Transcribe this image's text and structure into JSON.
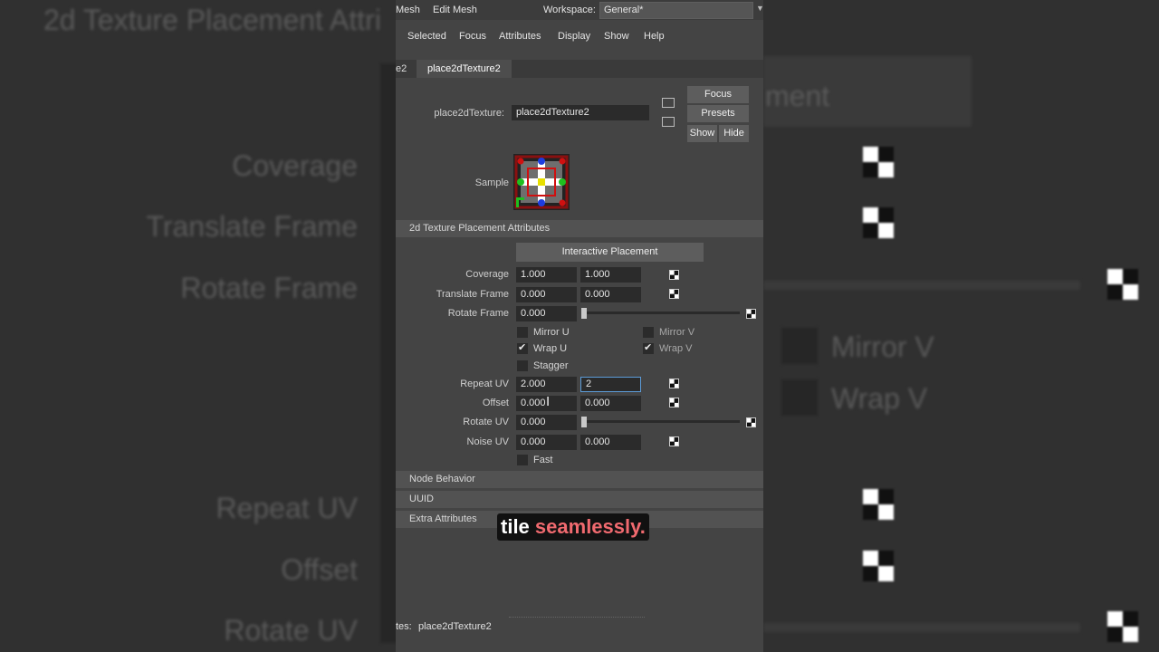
{
  "background": {
    "left_labels": [
      "2d Texture Placement Attri",
      "Coverage",
      "Translate Frame",
      "Rotate Frame",
      "Repeat UV",
      "Offset",
      "Rotate UV"
    ],
    "right_labels": [
      "ment",
      "Mirror V",
      "Wrap V"
    ]
  },
  "topbar": {
    "items": [
      "Mesh",
      "Edit Mesh"
    ],
    "workspace_label": "Workspace:",
    "workspace_value": "General*"
  },
  "menu": [
    "Selected",
    "Focus",
    "Attributes",
    "Display",
    "Show",
    "Help"
  ],
  "tabs": [
    "e2",
    "place2dTexture2"
  ],
  "node": {
    "label": "place2dTexture:",
    "value": "place2dTexture2",
    "focus": "Focus",
    "presets": "Presets",
    "show": "Show",
    "hide": "Hide",
    "sample_label": "Sample"
  },
  "section_main": "2d Texture Placement Attributes",
  "interactive_placement": "Interactive Placement",
  "attrs": {
    "coverage": {
      "label": "Coverage",
      "u": "1.000",
      "v": "1.000"
    },
    "translate_frame": {
      "label": "Translate Frame",
      "u": "0.000",
      "v": "0.000"
    },
    "rotate_frame": {
      "label": "Rotate Frame",
      "value": "0.000"
    },
    "mirror_u": {
      "label": "Mirror U",
      "checked": false
    },
    "mirror_v": {
      "label": "Mirror V",
      "checked": false
    },
    "wrap_u": {
      "label": "Wrap U",
      "checked": true
    },
    "wrap_v": {
      "label": "Wrap V",
      "checked": true
    },
    "stagger": {
      "label": "Stagger",
      "checked": false
    },
    "repeat_uv": {
      "label": "Repeat UV",
      "u": "2.000",
      "v": "2"
    },
    "offset": {
      "label": "Offset",
      "u": "0.000",
      "v": "0.000"
    },
    "rotate_uv": {
      "label": "Rotate UV",
      "value": "0.000"
    },
    "noise_uv": {
      "label": "Noise UV",
      "u": "0.000",
      "v": "0.000"
    },
    "fast": {
      "label": "Fast",
      "checked": false
    }
  },
  "sections": [
    "Node Behavior",
    "UUID",
    "Extra Attributes"
  ],
  "caption": {
    "word1": "tile",
    "word2": "seamlessly."
  },
  "footer": {
    "label": "tes:",
    "value": "place2dTexture2"
  }
}
